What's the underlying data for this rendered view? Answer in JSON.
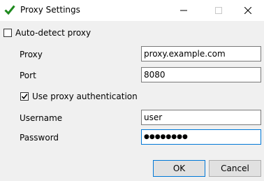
{
  "window": {
    "title": "Proxy Settings",
    "accent": "#0078d7"
  },
  "titlebar_icons": [
    "checkmark-icon",
    "minimize-icon",
    "maximize-icon",
    "close-icon"
  ],
  "auto_detect": {
    "label": "Auto-detect proxy",
    "checked": false
  },
  "proxy": {
    "label": "Proxy",
    "value": "proxy.example.com"
  },
  "port": {
    "label": "Port",
    "value": "8080"
  },
  "use_auth": {
    "label": "Use proxy authentication",
    "checked": true
  },
  "username": {
    "label": "Username",
    "value": "user"
  },
  "password": {
    "label": "Password",
    "masked_value": "●●●●●●●●"
  },
  "buttons": {
    "ok": "OK",
    "cancel": "Cancel"
  }
}
